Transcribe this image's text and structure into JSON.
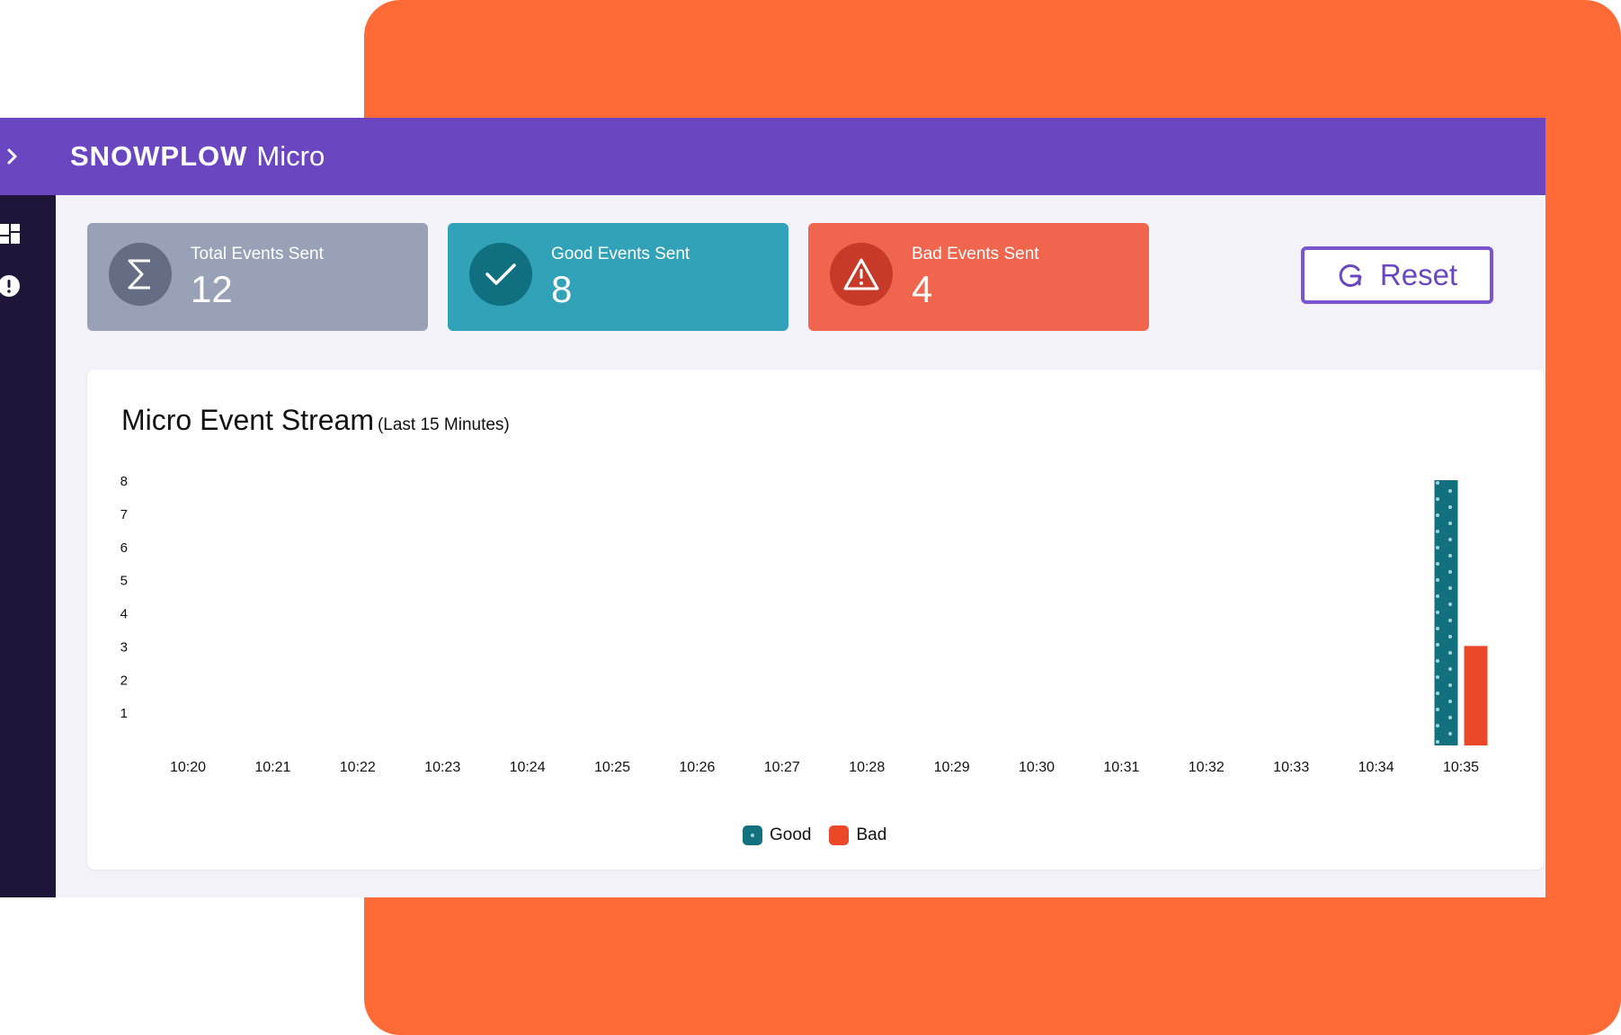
{
  "app": {
    "brand_bold": "SNOWPLOW",
    "brand_light": "Micro"
  },
  "sidebar": {
    "items": [
      {
        "icon": "dashboard-icon"
      },
      {
        "icon": "alert-icon"
      }
    ]
  },
  "stats": [
    {
      "label": "Total Events Sent",
      "value": "12",
      "icon": "sigma-icon"
    },
    {
      "label": "Good Events Sent",
      "value": "8",
      "icon": "check-icon"
    },
    {
      "label": "Bad Events Sent",
      "value": "4",
      "icon": "warning-icon"
    }
  ],
  "reset": {
    "label": "Reset",
    "icon": "refresh-icon"
  },
  "chart": {
    "title": "Micro Event Stream",
    "subtitle": "(Last 15 Minutes)"
  },
  "colors": {
    "brand": "#6b46c1",
    "good": "#13707f",
    "bad": "#eb4829",
    "card_total": "#98a1b5",
    "card_good": "#31a2b8",
    "card_bad": "#ef654d"
  },
  "chart_data": {
    "type": "bar",
    "title": "Micro Event Stream",
    "subtitle": "(Last 15 Minutes)",
    "categories": [
      "10:20",
      "10:21",
      "10:22",
      "10:23",
      "10:24",
      "10:25",
      "10:26",
      "10:27",
      "10:28",
      "10:29",
      "10:30",
      "10:31",
      "10:32",
      "10:33",
      "10:34",
      "10:35"
    ],
    "series": [
      {
        "name": "Good",
        "color": "#13707f",
        "pattern": "dots",
        "values": [
          0,
          0,
          0,
          0,
          0,
          0,
          0,
          0,
          0,
          0,
          0,
          0,
          0,
          0,
          0,
          8
        ]
      },
      {
        "name": "Bad",
        "color": "#eb4829",
        "values": [
          0,
          0,
          0,
          0,
          0,
          0,
          0,
          0,
          0,
          0,
          0,
          0,
          0,
          0,
          0,
          3
        ]
      }
    ],
    "yticks": [
      1,
      2,
      3,
      4,
      5,
      6,
      7,
      8
    ],
    "ylim": [
      0,
      8
    ],
    "legend": "bottom-center",
    "grid": false
  }
}
